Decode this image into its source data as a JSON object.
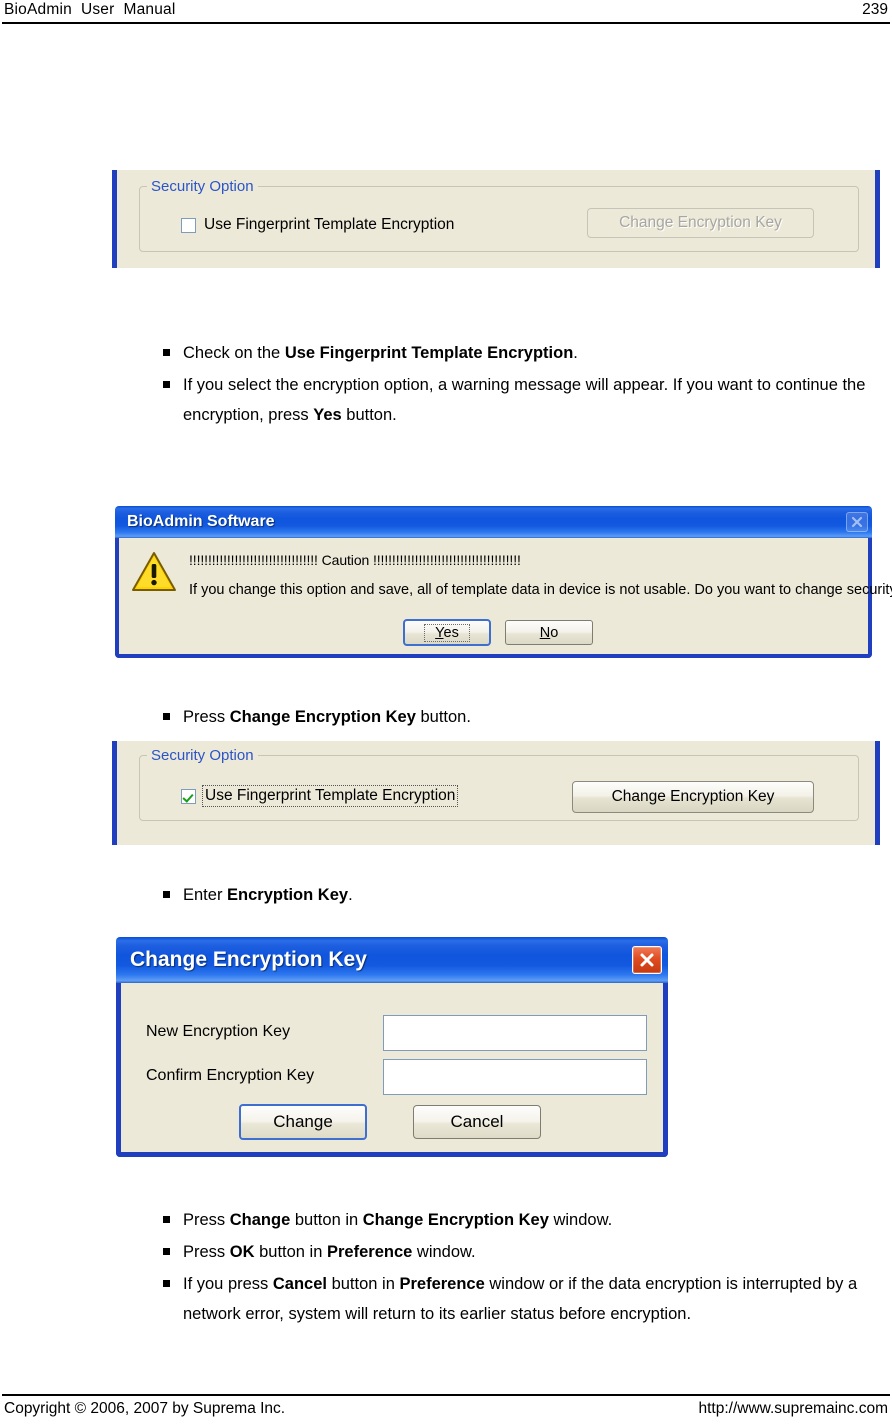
{
  "header": {
    "title": "BioAdmin  User  Manual",
    "page_number": "239"
  },
  "footer": {
    "copyright": "Copyright © 2006, 2007 by Suprema Inc.",
    "url": "http://www.supremainc.com"
  },
  "security_panel_unchecked": {
    "group_label": "Security Option",
    "checkbox_label": "Use Fingerprint Template Encryption",
    "checkbox_checked": false,
    "button_label": "Change Encryption Key",
    "button_disabled": true,
    "accent_color": "#1f3fbe",
    "label_color": "#2b54c8",
    "face_color": "#ece9d8"
  },
  "security_panel_checked": {
    "group_label": "Security Option",
    "checkbox_label": "Use Fingerprint Template Encryption",
    "checkbox_checked": true,
    "button_label": "Change Encryption Key",
    "button_disabled": false,
    "accent_color": "#1f3fbe",
    "label_color": "#2b54c8",
    "face_color": "#ece9d8"
  },
  "bullets_top": [
    {
      "html": "Check on the <b>Use Fingerprint Template Encryption</b>."
    },
    {
      "html": "If you select the encryption option, a warning message will appear. If you want to continue the encryption, press <b>Yes</b> button."
    }
  ],
  "bullet_change_key": {
    "html": "Press <b>Change Encryption Key</b> button."
  },
  "bullet_enter_key": {
    "html": "Enter <b>Encryption Key</b>."
  },
  "bullets_bottom": [
    {
      "html": "Press <b>Change</b> button in <b>Change Encryption Key</b> window."
    },
    {
      "html": "Press <b>OK</b> button in <b>Preference</b> window."
    },
    {
      "html": "If you press <b>Cancel</b> button in <b>Preference</b> window or if the data encryption is interrupted by a network error, system will return to its earlier status before encryption."
    }
  ],
  "warning_dialog": {
    "title": "BioAdmin Software",
    "close_enabled": false,
    "icon": "warning-triangle-icon",
    "caution_line": "!!!!!!!!!!!!!!!!!!!!!!!!!!!!!!!!!! Caution !!!!!!!!!!!!!!!!!!!!!!!!!!!!!!!!!!!!!!!",
    "message": "If you change this option and save, all of template data in device is not usable. Do you want to change security option?",
    "buttons": [
      {
        "label": "Yes",
        "accel": "Y",
        "default": true
      },
      {
        "label": "No",
        "accel": "N",
        "default": false
      }
    ],
    "titlebar_color": "#1f5fe0"
  },
  "change_key_dialog": {
    "title": "Change Encryption Key",
    "close_enabled": true,
    "close_color": "#df4c22",
    "fields": [
      {
        "label": "New Encryption Key",
        "value": "",
        "placeholder": ""
      },
      {
        "label": "Confirm Encryption Key",
        "value": "",
        "placeholder": ""
      }
    ],
    "buttons": [
      {
        "label": "Change",
        "default": true
      },
      {
        "label": "Cancel",
        "default": false
      }
    ],
    "titlebar_color": "#1f5fe0"
  }
}
